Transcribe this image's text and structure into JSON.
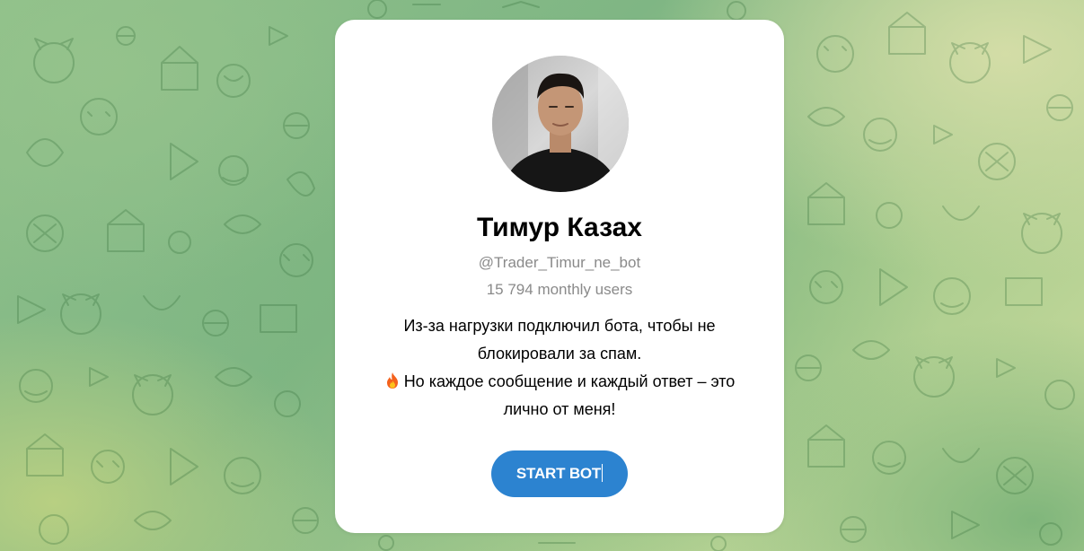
{
  "bot": {
    "name": "Тимур Казах",
    "username": "@Trader_Timur_ne_bot",
    "monthly_users": "15 794 monthly users",
    "description_line1": "Из-за нагрузки подключил бота, чтобы не",
    "description_line2": "блокировали за спам.",
    "description_line3": "Но каждое сообщение и каждый ответ – это",
    "description_line4": "лично от меня!",
    "description_emoji": "fire-icon",
    "start_label": "START BOT"
  },
  "colors": {
    "button": "#2c83d0",
    "secondary_text": "#8a8a8a",
    "background_green": "#7fb684"
  }
}
